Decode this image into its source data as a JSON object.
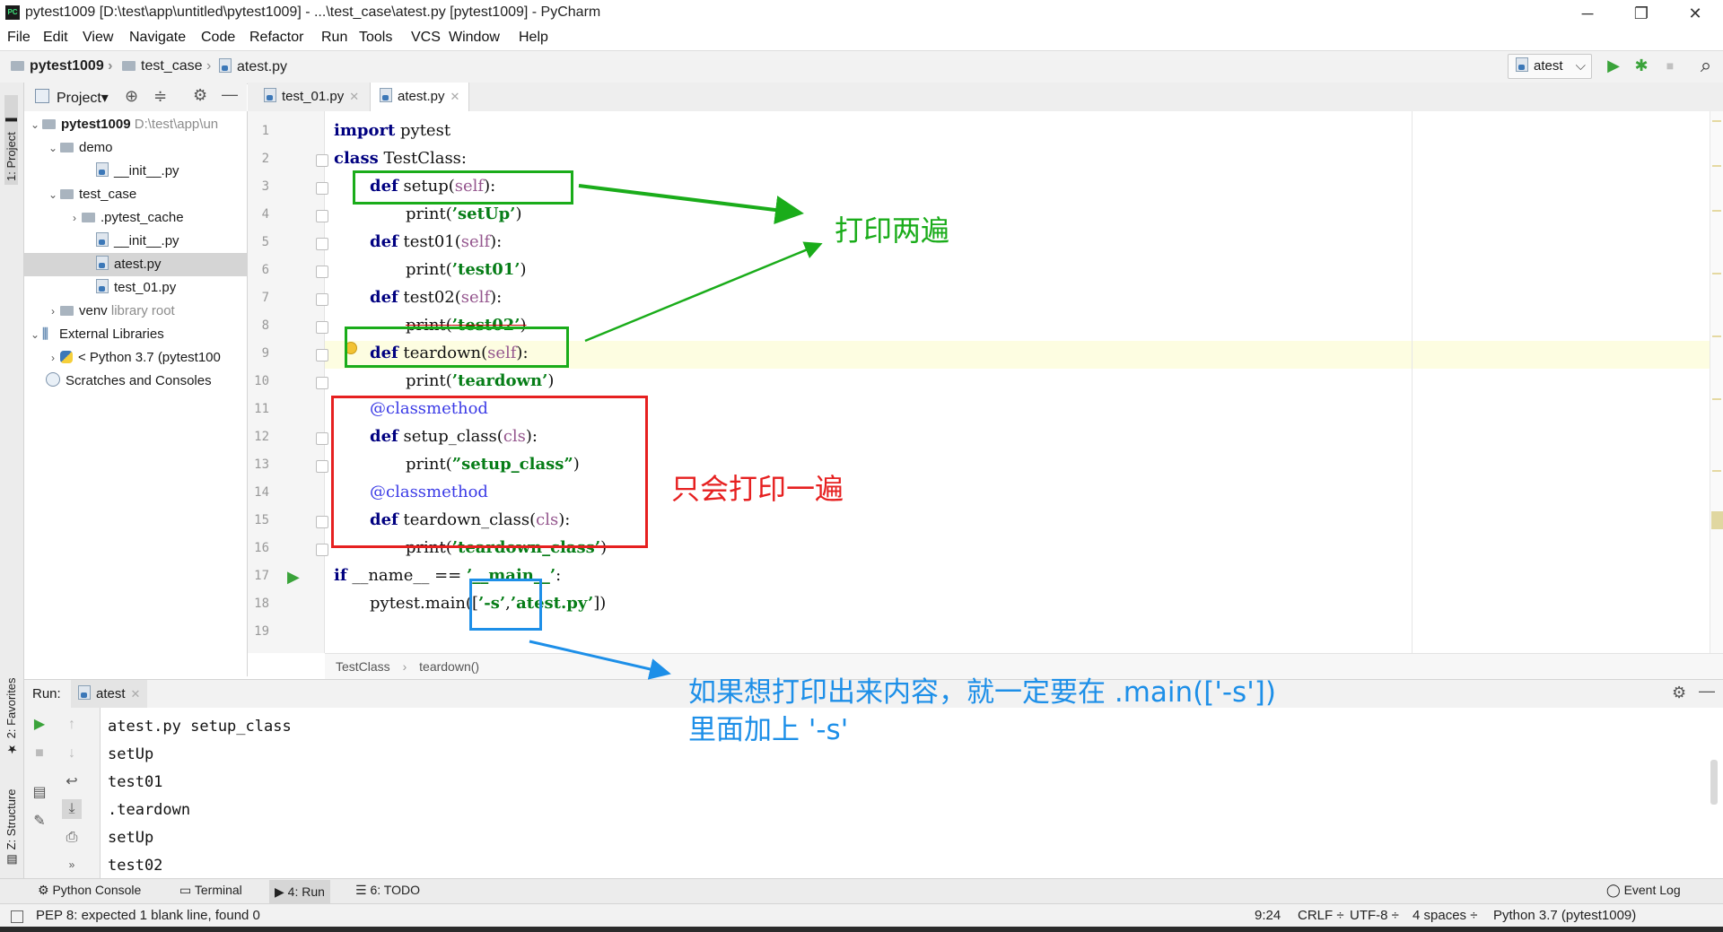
{
  "window": {
    "title": "pytest1009 [D:\\test\\app\\untitled\\pytest1009] - ...\\test_case\\atest.py [pytest1009] - PyCharm",
    "logo": "PC",
    "minimize": "─",
    "restore": "❐",
    "close": "✕"
  },
  "menu": [
    "File",
    "Edit",
    "View",
    "Navigate",
    "Code",
    "Refactor",
    "Run",
    "Tools",
    "VCS",
    "Window",
    "Help"
  ],
  "breadcrumb": {
    "project": "pytest1009",
    "folder": "test_case",
    "file": "atest.py"
  },
  "run_config": {
    "label": "atest",
    "arrow": "⌵"
  },
  "toolbar_icons": {
    "run": "▶",
    "debug": "✱",
    "stop": "■",
    "search": "⌕"
  },
  "left_stripe": {
    "project": "1: Project",
    "favorites": "2: Favorites",
    "structure": "Z: Structure"
  },
  "project_panel": {
    "title": "Project",
    "dropdown": "▾",
    "tree": [
      {
        "label": "pytest1009",
        "extra": "D:\\test\\app\\un",
        "depth": 0,
        "chev": "⌄",
        "icon": "folder"
      },
      {
        "label": "demo",
        "extra": "",
        "depth": 1,
        "chev": "⌄",
        "icon": "folder"
      },
      {
        "label": "__init__.py",
        "extra": "",
        "depth": 2,
        "chev": "",
        "icon": "pyfile"
      },
      {
        "label": "test_case",
        "extra": "",
        "depth": 1,
        "chev": "⌄",
        "icon": "folder"
      },
      {
        "label": ".pytest_cache",
        "extra": "",
        "depth": 2,
        "chev": "›",
        "icon": "folder"
      },
      {
        "label": "__init__.py",
        "extra": "",
        "depth": 2,
        "chev": "",
        "icon": "pyfile"
      },
      {
        "label": "atest.py",
        "extra": "",
        "depth": 2,
        "chev": "",
        "icon": "pyfile"
      },
      {
        "label": "test_01.py",
        "extra": "",
        "depth": 2,
        "chev": "",
        "icon": "pyfile"
      },
      {
        "label": "venv",
        "extra": "library root",
        "depth": 1,
        "chev": "›",
        "icon": "folder"
      },
      {
        "label": "External Libraries",
        "extra": "",
        "depth": 0,
        "chev": "⌄",
        "icon": "lib"
      },
      {
        "label": "< Python 3.7 (pytest100",
        "extra": "",
        "depth": 1,
        "chev": "›",
        "icon": "python"
      },
      {
        "label": "Scratches and Consoles",
        "extra": "",
        "depth": 0,
        "chev": "",
        "icon": "scratch"
      }
    ]
  },
  "tabs": [
    {
      "label": "test_01.py",
      "active": false
    },
    {
      "label": "atest.py",
      "active": true
    }
  ],
  "tab_close": "✕",
  "line_numbers": [
    "1",
    "2",
    "3",
    "4",
    "5",
    "6",
    "7",
    "8",
    "9",
    "10",
    "11",
    "12",
    "13",
    "14",
    "15",
    "16",
    "17",
    "18",
    "19"
  ],
  "code": {
    "l1_kw": "import",
    "l1_rest": " pytest",
    "l2_kw": "class",
    "l2_rest": " TestClass:",
    "l3_kw": "def",
    "l3_name": " setup(",
    "l3_self": "self",
    "l3_end": "):",
    "l4_fn": "print(",
    "l4_str": "’setUp’",
    "l4_end": ")",
    "l5_kw": "def",
    "l5_name": " test01(",
    "l5_self": "self",
    "l5_end": "):",
    "l6_fn": "print(",
    "l6_str": "’test01’",
    "l6_end": ")",
    "l7_kw": "def",
    "l7_name": " test02(",
    "l7_self": "self",
    "l7_end": "):",
    "l8_fn": "print(",
    "l8_str": "’test02’",
    "l8_end": ")",
    "l9_kw": "def",
    "l9_name": " teardown(",
    "l9_self": "self",
    "l9_end": "):",
    "l10_fn": "print(",
    "l10_str": "’teardown’",
    "l10_end": ")",
    "l11_deco": "@classmethod",
    "l12_kw": "def",
    "l12_name": " setup_class(",
    "l12_cls": "cls",
    "l12_end": "):",
    "l13_fn": "print(",
    "l13_str": "”setup_class”",
    "l13_end": ")",
    "l14_deco": "@classmethod",
    "l15_kw": "def",
    "l15_name": " teardown_class(",
    "l15_cls": "cls",
    "l15_end": "):",
    "l16_fn": "print(",
    "l16_str": "’teardown_class’",
    "l16_end": ")",
    "l17_kw": "if",
    "l17_mid": " __name__ == ",
    "l17_str": "’__main__’",
    "l17_end": ":",
    "l18_pre": "pytest.main([",
    "l18_s": "’-s’",
    "l18_mid": ",",
    "l18_file": "’atest.py’",
    "l18_end": "])"
  },
  "editor_breadcrumb": {
    "class": "TestClass",
    "sep": "›",
    "method": "teardown()"
  },
  "run_panel": {
    "label": "Run:",
    "tab": "atest",
    "output": [
      "atest.py setup_class",
      "setUp",
      "test01",
      ".teardown",
      "setUp",
      "test02"
    ]
  },
  "bottom_tools": [
    {
      "label": "Python Console",
      "active": false
    },
    {
      "label": "Terminal",
      "active": false
    },
    {
      "label": "4: Run",
      "active": true
    },
    {
      "label": "6: TODO",
      "active": false
    }
  ],
  "event_log": "Event Log",
  "status": {
    "message": "PEP 8: expected 1 blank line, found 0",
    "position": "9:24",
    "line_sep": "CRLF ÷",
    "encoding": "UTF-8 ÷",
    "indent": "4 spaces ÷",
    "interpreter": "Python 3.7 (pytest1009)"
  },
  "annotations": {
    "green_text": "打印两遍",
    "red_text": "只会打印一遍",
    "blue_text_1": "如果想打印出来内容，就一定要在 .main(['-s'])",
    "blue_text_2": "里面加上 '-s'"
  },
  "colors": {
    "green": "#1aac1a",
    "red": "#e62020",
    "blue": "#1d8fe8",
    "keyword": "#000080",
    "string": "#067d17",
    "self": "#94558d",
    "decorator": "#3a3ae6"
  }
}
